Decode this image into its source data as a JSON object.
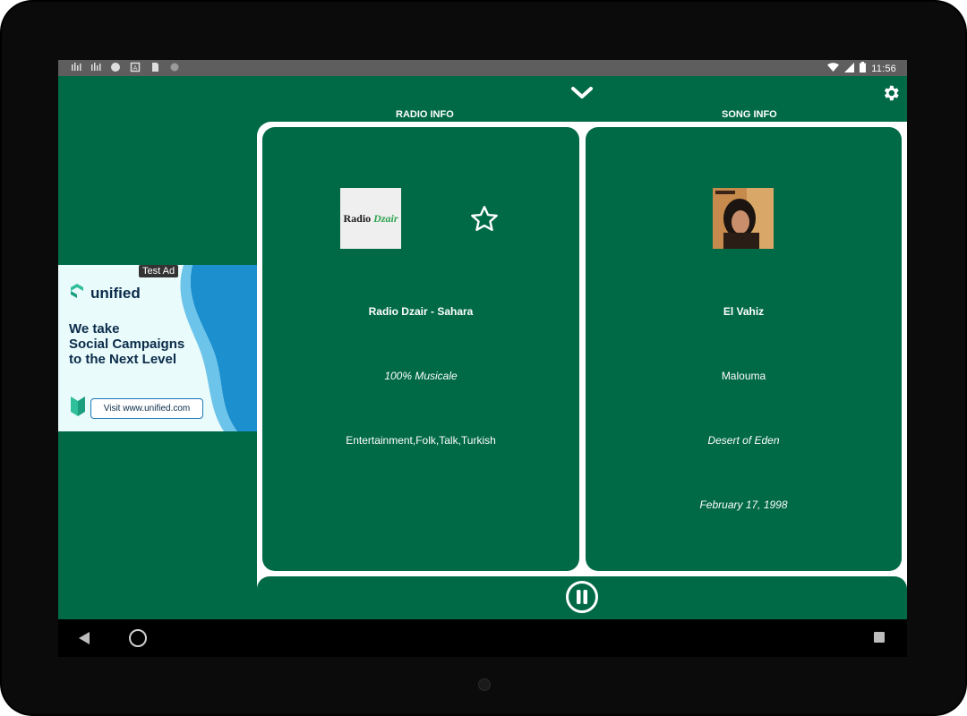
{
  "status_bar": {
    "time": "11:56"
  },
  "header": {
    "radio_info_label": "RADIO INFO",
    "song_info_label": "SONG INFO"
  },
  "radio": {
    "logo_text": "Radio",
    "logo_accent": "Dzair",
    "name": "Radio Dzair - Sahara",
    "tagline": "100% Musicale",
    "genres": "Entertainment,Folk,Talk,Turkish"
  },
  "song": {
    "title": "El Vahiz",
    "artist": "Malouma",
    "album": "Desert of Eden",
    "release_date": "February 17, 1998"
  },
  "ad": {
    "badge": "Test Ad",
    "brand": "unified",
    "headline": "We take\nSocial Campaigns\nto the Next Level",
    "cta": "Visit www.unified.com"
  },
  "colors": {
    "primary": "#006946",
    "frame": "#ffffff",
    "ad_bg": "#e9fbfb",
    "ad_accent": "#1c8fcf"
  },
  "icons": [
    "chevron-down-icon",
    "settings-gear-icon",
    "favorite-star-icon",
    "pause-icon",
    "back-icon",
    "home-icon",
    "recents-icon"
  ]
}
